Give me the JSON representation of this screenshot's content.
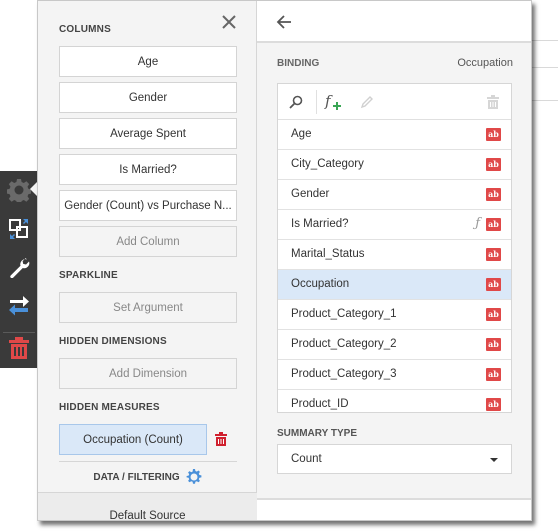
{
  "toolbar": {
    "items": [
      {
        "icon": "gear-icon",
        "label": "Options"
      },
      {
        "icon": "convert-icon",
        "label": "Convert"
      },
      {
        "icon": "wrench-icon",
        "label": "Settings"
      },
      {
        "icon": "swap-icon",
        "label": "Interactivity"
      },
      {
        "icon": "trash-icon",
        "label": "Delete"
      }
    ],
    "colors": {
      "accent": "#4a90d9",
      "danger": "#e04848"
    }
  },
  "left_panel": {
    "columns_title": "COLUMNS",
    "columns": [
      "Age",
      "Gender",
      "Average Spent",
      "Is Married?",
      "Gender (Count) vs Purchase N..."
    ],
    "add_column": "Add Column",
    "sparkline_title": "SPARKLINE",
    "set_argument": "Set Argument",
    "hidden_dimensions_title": "HIDDEN DIMENSIONS",
    "add_dimension": "Add Dimension",
    "hidden_measures_title": "HIDDEN MEASURES",
    "hidden_measures": [
      "Occupation (Count)"
    ],
    "data_filtering": "DATA / FILTERING",
    "default_source": "Default Source"
  },
  "right_panel": {
    "binding_label": "BINDING",
    "binding_value": "Occupation",
    "fields": [
      {
        "name": "Age",
        "type": "ab",
        "calculated": false,
        "selected": false
      },
      {
        "name": "City_Category",
        "type": "ab",
        "calculated": false,
        "selected": false
      },
      {
        "name": "Gender",
        "type": "ab",
        "calculated": false,
        "selected": false
      },
      {
        "name": "Is Married?",
        "type": "ab",
        "calculated": true,
        "selected": false
      },
      {
        "name": "Marital_Status",
        "type": "ab",
        "calculated": false,
        "selected": false
      },
      {
        "name": "Occupation",
        "type": "ab",
        "calculated": false,
        "selected": true
      },
      {
        "name": "Product_Category_1",
        "type": "ab",
        "calculated": false,
        "selected": false
      },
      {
        "name": "Product_Category_2",
        "type": "ab",
        "calculated": false,
        "selected": false
      },
      {
        "name": "Product_Category_3",
        "type": "ab",
        "calculated": false,
        "selected": false
      },
      {
        "name": "Product_ID",
        "type": "ab",
        "calculated": false,
        "selected": false
      }
    ],
    "calc_mark": "ƒ",
    "summary_type_label": "SUMMARY TYPE",
    "summary_type_value": "Count"
  }
}
